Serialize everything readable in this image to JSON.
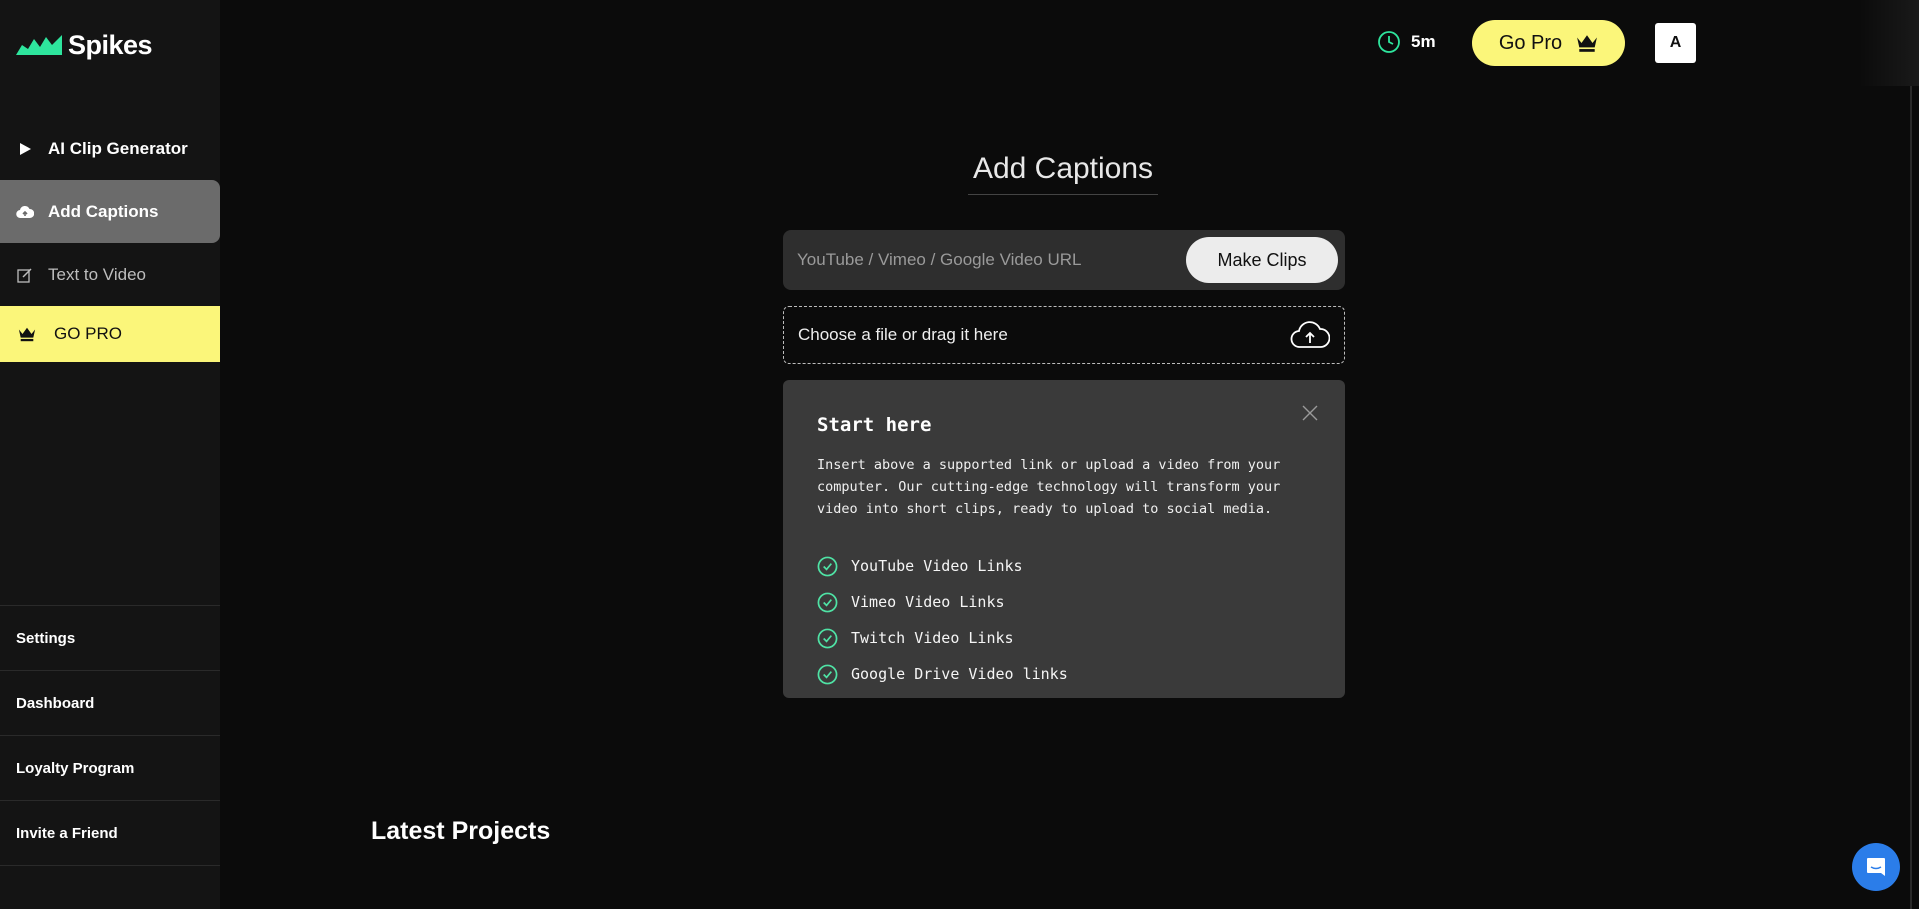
{
  "brand": {
    "name": "Spikes",
    "accent": "#2ee59d"
  },
  "sidebar": {
    "items": [
      {
        "label": "AI Clip Generator",
        "icon": "play-icon"
      },
      {
        "label": "Add Captions",
        "icon": "cloud-upload-icon"
      },
      {
        "label": "Text to Video",
        "icon": "edit-icon"
      },
      {
        "label": "GO PRO",
        "icon": "crown-icon"
      }
    ],
    "bottom": [
      "Settings",
      "Dashboard",
      "Loyalty Program",
      "Invite a Friend"
    ]
  },
  "topbar": {
    "credits": "5m",
    "gopro_label": "Go Pro",
    "avatar_initial": "A"
  },
  "main": {
    "title": "Add Captions",
    "url_placeholder": "YouTube / Vimeo / Google Video URL",
    "make_clips_label": "Make Clips",
    "dropzone_label": "Choose a file or drag it here",
    "card": {
      "title": "Start here",
      "description": "Insert above a supported link or upload a video from your computer. Our cutting-edge technology will transform your video into short clips, ready to upload to social media.",
      "list": [
        "YouTube Video Links",
        "Vimeo Video Links",
        "Twitch Video Links",
        "Google Drive Video links"
      ]
    },
    "latest_title": "Latest Projects"
  },
  "colors": {
    "yellow": "#fbf67a",
    "check": "#4fe3a5",
    "chat": "#2b7de9"
  }
}
